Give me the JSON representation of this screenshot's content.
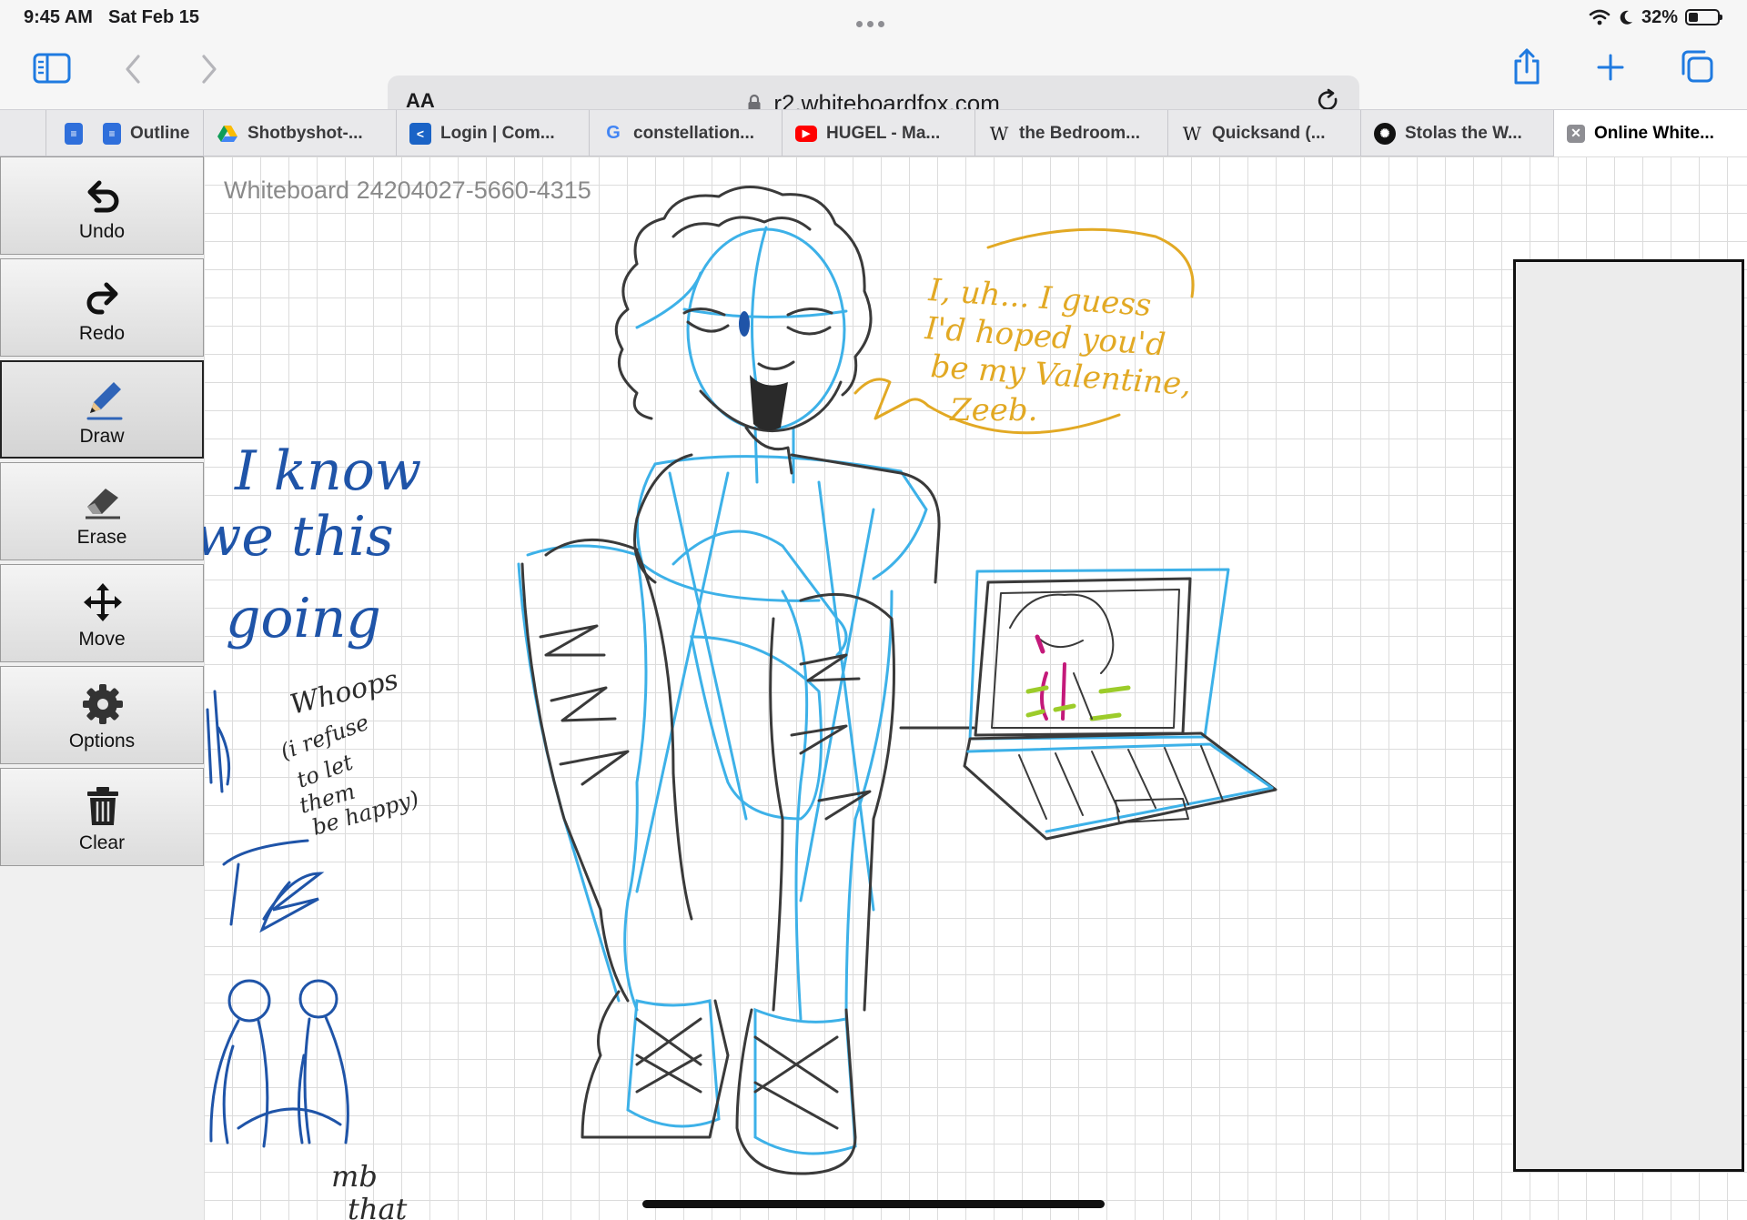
{
  "status_bar": {
    "time": "9:45 AM",
    "date": "Sat Feb 15",
    "battery_percent": "32%",
    "battery_level": 0.32
  },
  "toolbar": {
    "reader_label": "AA",
    "url": "r2.whiteboardfox.com",
    "icons": [
      "sidebar-icon",
      "back-icon",
      "forward-icon",
      "lock-icon",
      "reload-icon",
      "share-icon",
      "new-tab-icon",
      "tab-overview-icon"
    ]
  },
  "tabs": [
    {
      "label": "Outline",
      "icon": "google-docs-icon"
    },
    {
      "label": "Shotbyshot-...",
      "icon": "google-drive-icon"
    },
    {
      "label": "Login | Com...",
      "icon": "portal-icon"
    },
    {
      "label": "constellation...",
      "icon": "google-icon"
    },
    {
      "label": "HUGEL - Ma...",
      "icon": "youtube-icon"
    },
    {
      "label": "the Bedroom...",
      "icon": "wikipedia-icon"
    },
    {
      "label": "Quicksand (...",
      "icon": "wikipedia-icon"
    },
    {
      "label": "Stolas the W...",
      "icon": "openai-icon"
    },
    {
      "label": "Online White...",
      "icon": "close-icon",
      "active": true
    }
  ],
  "tools": [
    {
      "label": "Undo",
      "icon": "undo-icon"
    },
    {
      "label": "Redo",
      "icon": "redo-icon"
    },
    {
      "label": "Draw",
      "icon": "pencil-icon",
      "active": true
    },
    {
      "label": "Erase",
      "icon": "eraser-icon"
    },
    {
      "label": "Move",
      "icon": "move-icon"
    },
    {
      "label": "Options",
      "icon": "gear-icon"
    },
    {
      "label": "Clear",
      "icon": "trash-icon"
    }
  ],
  "whiteboard": {
    "title": "Whiteboard 24204027-5660-4315",
    "handwriting": {
      "speech": [
        "I, uh... I guess",
        "I'd hoped you'd",
        "be my Valentine,",
        "Zeeb."
      ],
      "left_notes": [
        "I know",
        "we this",
        "going"
      ],
      "whoops_note": [
        "Whoops",
        "(i refuse",
        "to let",
        "them",
        "be happy)"
      ],
      "bottom_note": [
        "mb",
        "that"
      ]
    },
    "colors": {
      "pencil": "#3a3a3a",
      "sketch_blue": "#3db1e8",
      "ink_blue": "#1f54a8",
      "speech_yellow": "#e2a924",
      "magenta": "#c4197a",
      "lime": "#9ccc2a"
    }
  }
}
